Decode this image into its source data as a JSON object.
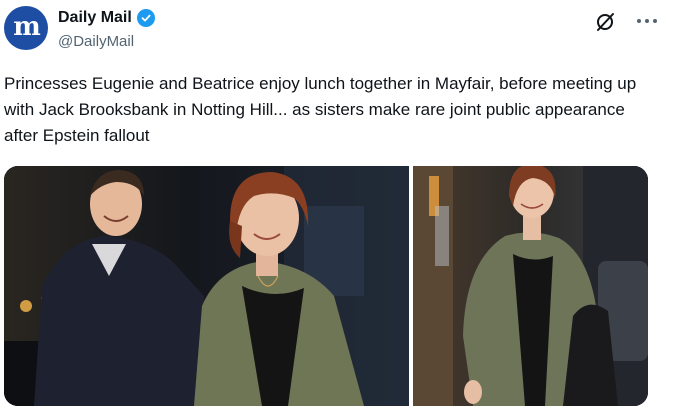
{
  "post": {
    "avatar_glyph": "m",
    "display_name": "Daily Mail",
    "handle": "@DailyMail",
    "verified": true,
    "text": "Princesses Eugenie and Beatrice enjoy lunch together in Mayfair, before meeting up with Jack Brooksbank in Notting Hill... as sisters make rare joint public appearance after Epstein fallout"
  },
  "icons": {
    "verified": "verified-badge-icon",
    "grok": "grok-icon",
    "more": "more-options-icon"
  },
  "colors": {
    "brand_blue": "#1d4ea3",
    "verified_blue": "#1d9bf0",
    "handle_gray": "#536471",
    "text": "#0f1419"
  },
  "media": {
    "photo_count": 2
  }
}
